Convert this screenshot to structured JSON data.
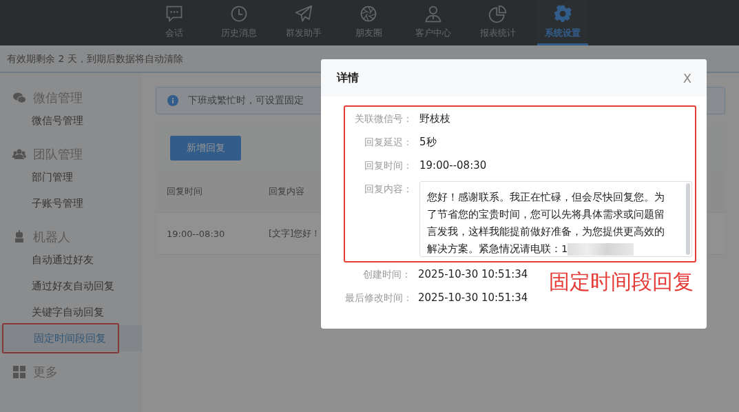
{
  "nav": {
    "items": [
      {
        "label": "会话",
        "selected": false
      },
      {
        "label": "历史消息",
        "selected": false
      },
      {
        "label": "群发助手",
        "selected": false
      },
      {
        "label": "朋友圈",
        "selected": false
      },
      {
        "label": "客户中心",
        "selected": false
      },
      {
        "label": "报表统计",
        "selected": false
      },
      {
        "label": "系统设置",
        "selected": true
      }
    ]
  },
  "expiry_notice": "有效期剩余 2 天，到期后数据将自动清除",
  "sidebar": {
    "groups": [
      {
        "title": "微信管理",
        "items": [
          {
            "label": "微信号管理",
            "selected": false,
            "annotated": false
          }
        ]
      },
      {
        "title": "团队管理",
        "items": [
          {
            "label": "部门管理",
            "selected": false,
            "annotated": false
          },
          {
            "label": "子账号管理",
            "selected": false,
            "annotated": false
          }
        ]
      },
      {
        "title": "机器人",
        "items": [
          {
            "label": "自动通过好友",
            "selected": false,
            "annotated": false
          },
          {
            "label": "通过好友自动回复",
            "selected": false,
            "annotated": false
          },
          {
            "label": "关键字自动回复",
            "selected": false,
            "annotated": false
          },
          {
            "label": "固定时间段回复",
            "selected": true,
            "annotated": true
          }
        ]
      },
      {
        "title": "更多"
      }
    ]
  },
  "info_banner": "下班或繁忙时，可设置固定",
  "add_button": "新增回复",
  "table": {
    "columns": [
      "回复时间",
      "回复内容"
    ],
    "rows": [
      [
        "19:00--08:30",
        "[文字]您好！"
      ]
    ]
  },
  "modal": {
    "title": "详情",
    "close": "X",
    "annotated_fields": [
      {
        "kind": "text",
        "label": "关联微信号：",
        "value": "野枝枝"
      },
      {
        "kind": "text",
        "label": "回复延迟：",
        "value": "5秒"
      },
      {
        "kind": "text",
        "label": "回复时间：",
        "value": "19:00--08:30"
      },
      {
        "kind": "textarea",
        "label": "回复内容：",
        "value": "您好！感谢联系。我正在忙碌，但会尽快回复您。为了节省您的宝贵时间，您可以先将具体需求或问题留言发我，这样我能提前做好准备，为您提供更高效的解决方案。紧急情况请电联：1",
        "redacted": true
      }
    ],
    "fields": [
      {
        "kind": "text",
        "label": "创建时间：",
        "value": "2025-10-30 10:51:34"
      },
      {
        "kind": "text",
        "label": "最后修改时间：",
        "value": "2025-10-30 10:51:34"
      }
    ],
    "annotation_caption": "固定时间段回复"
  }
}
